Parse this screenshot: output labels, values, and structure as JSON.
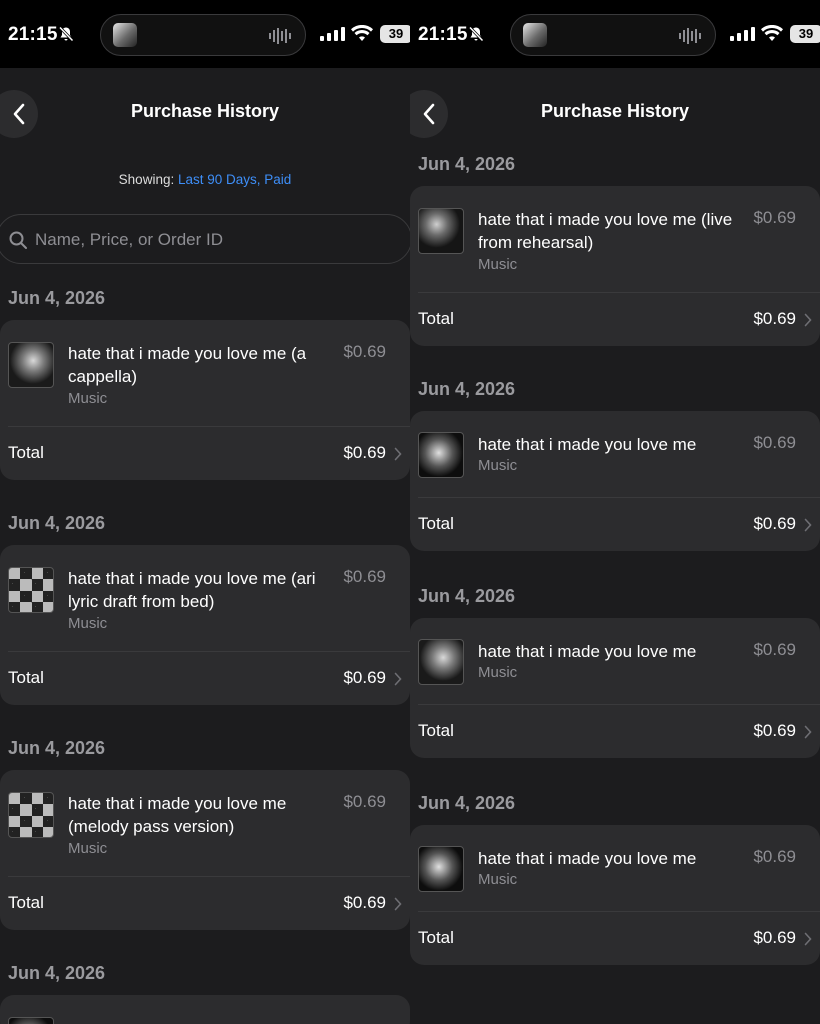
{
  "status": {
    "time": "21:15",
    "battery": "39"
  },
  "header": {
    "title": "Purchase History",
    "back_icon": "chevron-left-icon"
  },
  "filter": {
    "prefix": "Showing:",
    "value": "Last 90 Days, Paid"
  },
  "search": {
    "placeholder": "Name, Price, or Order ID"
  },
  "left_purchases": [
    {
      "date": "Jun 4, 2026",
      "title": "hate that i made you love me (a cappella)",
      "kind": "Music",
      "price": "$0.69",
      "total_label": "Total",
      "total": "$0.69"
    },
    {
      "date": "Jun 4, 2026",
      "title": "hate that i made you love me (ari lyric draft from bed)",
      "kind": "Music",
      "price": "$0.69",
      "total_label": "Total",
      "total": "$0.69"
    },
    {
      "date": "Jun 4, 2026",
      "title": "hate that i made you love me (melody pass version)",
      "kind": "Music",
      "price": "$0.69",
      "total_label": "Total",
      "total": "$0.69"
    },
    {
      "date": "Jun 4, 2026"
    }
  ],
  "right_purchases": [
    {
      "date": "Jun 4, 2026",
      "title": "hate that i made you love me (live from rehearsal)",
      "kind": "Music",
      "price": "$0.69",
      "total_label": "Total",
      "total": "$0.69"
    },
    {
      "date": "Jun 4, 2026",
      "title": "hate that i made you love me",
      "kind": "Music",
      "price": "$0.69",
      "total_label": "Total",
      "total": "$0.69"
    },
    {
      "date": "Jun 4, 2026",
      "title": "hate that i made you love me",
      "kind": "Music",
      "price": "$0.69",
      "total_label": "Total",
      "total": "$0.69"
    },
    {
      "date": "Jun 4, 2026",
      "title": "hate that i made you love me",
      "kind": "Music",
      "price": "$0.69",
      "total_label": "Total",
      "total": "$0.69"
    }
  ]
}
